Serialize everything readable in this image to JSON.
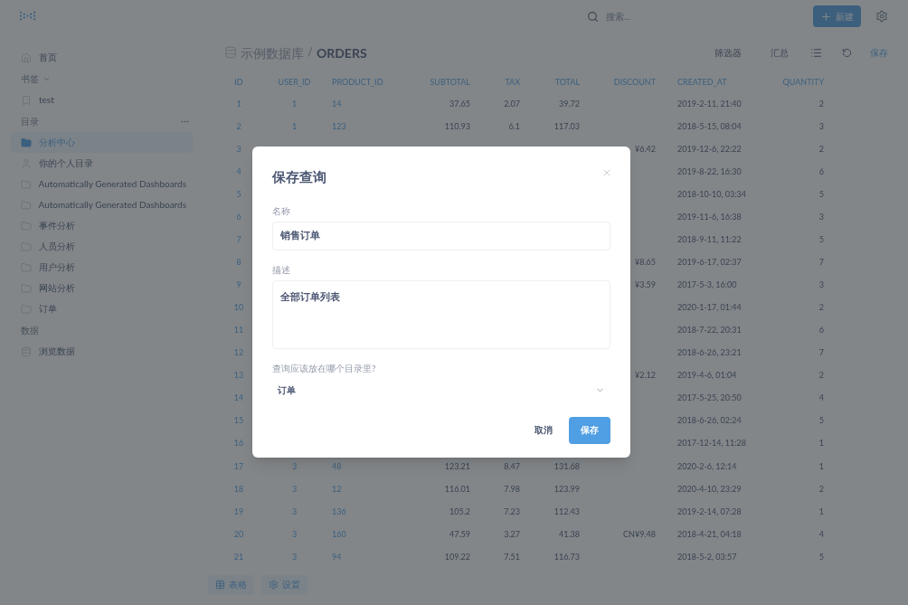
{
  "topbar": {
    "search": {
      "placeholder": "搜索..."
    },
    "new_button": "新建"
  },
  "sidebar": {
    "home": "首页",
    "bookmarks": {
      "label": "书签",
      "items": [
        "test"
      ]
    },
    "collections": {
      "label": "目录",
      "items": [
        {
          "label": "分析中心",
          "selected": true,
          "kind": "folder"
        },
        {
          "label": "你的个人目录",
          "selected": false,
          "kind": "person"
        },
        {
          "label": "Automatically Generated Dashboards",
          "selected": false,
          "kind": "folder"
        },
        {
          "label": "Automatically Generated Dashboards",
          "selected": false,
          "kind": "folder"
        },
        {
          "label": "事件分析",
          "selected": false,
          "kind": "folder"
        },
        {
          "label": "人员分析",
          "selected": false,
          "kind": "folder"
        },
        {
          "label": "用户分析",
          "selected": false,
          "kind": "folder"
        },
        {
          "label": "网站分析",
          "selected": false,
          "kind": "folder"
        },
        {
          "label": "订单",
          "selected": false,
          "kind": "folder"
        }
      ]
    },
    "data": {
      "label": "数据",
      "items": [
        "浏览数据"
      ]
    }
  },
  "breadcrumb": {
    "database": "示例数据库",
    "separator": "/",
    "table": "ORDERS"
  },
  "toolbar": {
    "filter": "筛选器",
    "summarize": "汇总",
    "save": "保存"
  },
  "table": {
    "columns": [
      "ID",
      "USER_ID",
      "PRODUCT_ID",
      "SUBTOTAL",
      "TAX",
      "TOTAL",
      "DISCOUNT",
      "CREATED_AT",
      "QUANTITY"
    ],
    "rows": [
      {
        "id": "1",
        "user_id": "1",
        "product_id": "14",
        "subtotal": "37.65",
        "tax": "2.07",
        "total": "39.72",
        "created_at": "2019-2-11, 21:40",
        "quantity": "2"
      },
      {
        "id": "2",
        "user_id": "1",
        "product_id": "123",
        "subtotal": "110.93",
        "tax": "6.1",
        "total": "117.03",
        "created_at": "2018-5-15, 08:04",
        "quantity": "3"
      },
      {
        "id": "3",
        "discount": "¥6.42",
        "created_at": "2019-12-6, 22:22",
        "quantity": "2"
      },
      {
        "id": "4",
        "created_at": "2019-8-22, 16:30",
        "quantity": "6"
      },
      {
        "id": "5",
        "created_at": "2018-10-10, 03:34",
        "quantity": "5"
      },
      {
        "id": "6",
        "created_at": "2019-11-6, 16:38",
        "quantity": "3"
      },
      {
        "id": "7",
        "created_at": "2018-9-11, 11:22",
        "quantity": "5"
      },
      {
        "id": "8",
        "discount": "¥8.65",
        "created_at": "2019-6-17, 02:37",
        "quantity": "7"
      },
      {
        "id": "9",
        "discount": "¥3.59",
        "created_at": "2017-5-3, 16:00",
        "quantity": "3"
      },
      {
        "id": "10",
        "created_at": "2020-1-17, 01:44",
        "quantity": "2"
      },
      {
        "id": "11",
        "created_at": "2018-7-22, 20:31",
        "quantity": "6"
      },
      {
        "id": "12",
        "created_at": "2018-6-26, 23:21",
        "quantity": "7"
      },
      {
        "id": "13",
        "discount": "¥2.12",
        "created_at": "2019-4-6, 01:04",
        "quantity": "2"
      },
      {
        "id": "14",
        "created_at": "2017-5-25, 20:50",
        "quantity": "4"
      },
      {
        "id": "15",
        "created_at": "2018-6-26, 02:24",
        "quantity": "5"
      },
      {
        "id": "16",
        "created_at": "2017-12-14, 11:28",
        "quantity": "1"
      },
      {
        "id": "17",
        "user_id": "3",
        "product_id": "48",
        "subtotal": "123.21",
        "tax": "8.47",
        "total": "131.68",
        "created_at": "2020-2-6, 12:14",
        "quantity": "1"
      },
      {
        "id": "18",
        "user_id": "3",
        "product_id": "12",
        "subtotal": "116.01",
        "tax": "7.98",
        "total": "123.99",
        "created_at": "2020-4-10, 23:29",
        "quantity": "2"
      },
      {
        "id": "19",
        "user_id": "3",
        "product_id": "136",
        "subtotal": "105.2",
        "tax": "7.23",
        "total": "112.43",
        "created_at": "2019-2-14, 07:28",
        "quantity": "1"
      },
      {
        "id": "20",
        "user_id": "3",
        "product_id": "160",
        "subtotal": "47.59",
        "tax": "3.27",
        "total": "41.38",
        "discount": "CN¥9.48",
        "created_at": "2018-4-21, 04:18",
        "quantity": "4"
      },
      {
        "id": "21",
        "user_id": "3",
        "product_id": "94",
        "subtotal": "109.22",
        "tax": "7.51",
        "total": "116.73",
        "created_at": "2018-5-2, 03:57",
        "quantity": "5"
      }
    ]
  },
  "footer": {
    "visualization": "表格",
    "settings": "设置"
  },
  "dialog": {
    "title": "保存查询",
    "name": {
      "label": "名称",
      "value": "销售订单"
    },
    "description": {
      "label": "描述",
      "value": "全部订单列表"
    },
    "collection": {
      "label": "查询应该放在哪个目录里?",
      "value": "订单"
    },
    "cancel": "取消",
    "save": "保存"
  }
}
